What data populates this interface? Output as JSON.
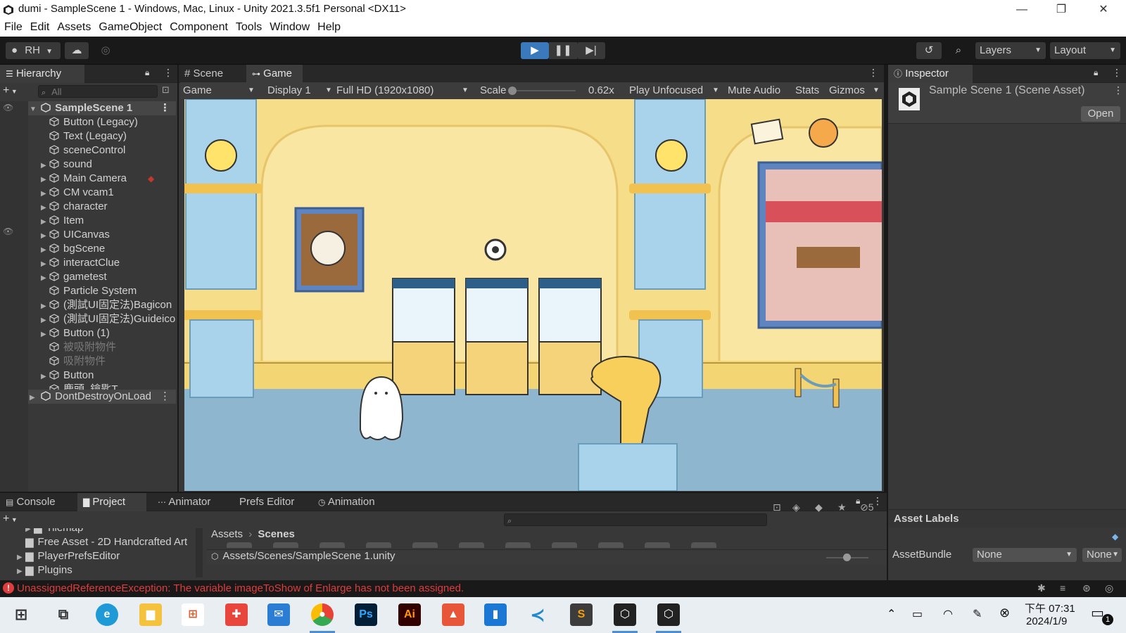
{
  "window": {
    "title": "dumi - SampleScene 1 - Windows, Mac, Linux - Unity 2021.3.5f1 Personal <DX11>",
    "minimize": "—",
    "maximize": "❐",
    "close": "✕"
  },
  "menu": [
    "File",
    "Edit",
    "Assets",
    "GameObject",
    "Component",
    "Tools",
    "Window",
    "Help"
  ],
  "toolbar": {
    "account": "RH",
    "layers": "Layers",
    "layout": "Layout"
  },
  "hierarchy": {
    "tab": "Hierarchy",
    "search_placeholder": "All",
    "scene": "SampleScene 1",
    "items": [
      {
        "label": "Button (Legacy)",
        "expand": ""
      },
      {
        "label": "Text (Legacy)",
        "expand": ""
      },
      {
        "label": "sceneControl",
        "expand": ""
      },
      {
        "label": "sound",
        "expand": "▶"
      },
      {
        "label": "Main Camera",
        "expand": "▶"
      },
      {
        "label": "CM vcam1",
        "expand": "▶"
      },
      {
        "label": "character",
        "expand": "▶"
      },
      {
        "label": "Item",
        "expand": "▶"
      },
      {
        "label": "UICanvas",
        "expand": "▶"
      },
      {
        "label": "bgScene",
        "expand": "▶"
      },
      {
        "label": "interactClue",
        "expand": "▶"
      },
      {
        "label": "gametest",
        "expand": "▶"
      },
      {
        "label": "Particle System",
        "expand": ""
      },
      {
        "label": "(測試UI固定法)Bagicon",
        "expand": "▶"
      },
      {
        "label": "(測試UI固定法)Guideicon",
        "expand": "▶"
      },
      {
        "label": "Button (1)",
        "expand": "▶"
      },
      {
        "label": "被吸附物件",
        "expand": ""
      },
      {
        "label": "吸附物件",
        "expand": ""
      },
      {
        "label": "Button",
        "expand": "▶"
      },
      {
        "label": "鹿頭_鑰匙T",
        "expand": ""
      }
    ],
    "dontdestroy": "DontDestroyOnLoad"
  },
  "center_tabs": {
    "scene": "Scene",
    "game": "Game"
  },
  "gamebar": {
    "display_mode": "Game",
    "display": "Display 1",
    "resolution": "Full HD (1920x1080)",
    "scale_label": "Scale",
    "scale_value": "0.62x",
    "play_mode": "Play Unfocused",
    "mute": "Mute Audio",
    "stats": "Stats",
    "gizmos": "Gizmos"
  },
  "inspector": {
    "tab": "Inspector",
    "asset_name": "Sample Scene 1 (Scene Asset)",
    "open_button": "Open",
    "asset_labels": "Asset Labels",
    "assetbundle_label": "AssetBundle",
    "assetbundle_value": "None",
    "variant_value": "None"
  },
  "bottom_tabs": [
    "Console",
    "Project",
    "Animator",
    "Prefs Editor",
    "Animation"
  ],
  "project": {
    "tree": [
      {
        "label": "Tilemap",
        "expand": "▶"
      },
      {
        "label": "Free Asset - 2D Handcrafted Art",
        "expand": ""
      },
      {
        "label": "PlayerPrefsEditor",
        "expand": "▶"
      },
      {
        "label": "Plugins",
        "expand": "▶"
      }
    ],
    "breadcrumb_root": "Assets",
    "breadcrumb_current": "Scenes",
    "selected_path": "Assets/Scenes/SampleScene 1.unity",
    "hidden_count": "5"
  },
  "console_error": "UnassignedReferenceException: The variable imageToShow of Enlarge has not been assigned.",
  "taskbar": {
    "time": "下午 07:31",
    "date": "2024/1/9",
    "notifications": "1",
    "apps": [
      "ps-icon",
      "ai-icon"
    ],
    "ps_label": "Ps",
    "ai_label": "Ai"
  },
  "colors": {
    "accent": "#3a79bb",
    "error": "#e03c3c",
    "game_wall": "#f6dd8a",
    "game_floor": "#8fb6cf"
  }
}
